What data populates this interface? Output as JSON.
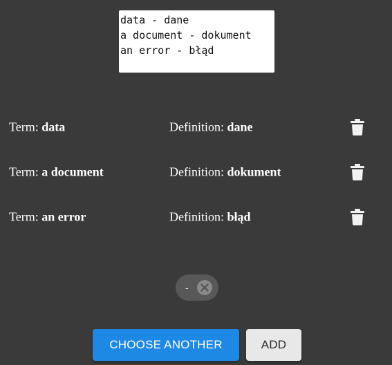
{
  "input": {
    "text": "data - dane\na document - dokument\nan error - błąd"
  },
  "labels": {
    "term_prefix": "Term: ",
    "definition_prefix": "Definition: "
  },
  "entries": [
    {
      "term": "data",
      "definition": "dane"
    },
    {
      "term": "a document",
      "definition": "dokument"
    },
    {
      "term": "an error",
      "definition": "błąd"
    }
  ],
  "chip": {
    "label": "-"
  },
  "buttons": {
    "choose_another": "CHOOSE ANOTHER",
    "add": "ADD"
  },
  "colors": {
    "background": "#3a3a3a",
    "primary": "#1e88e5",
    "secondary": "#e8e8e8",
    "chip": "#585858"
  },
  "icons": {
    "delete": "trash-icon",
    "chip_close": "close-circle-icon"
  }
}
